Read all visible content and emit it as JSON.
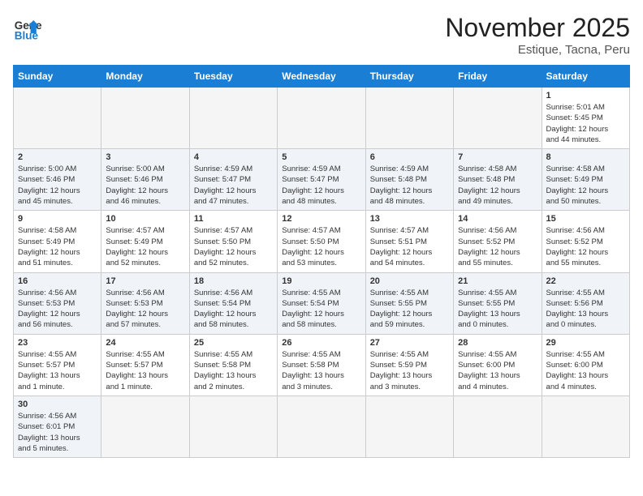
{
  "header": {
    "logo_line1": "General",
    "logo_line2": "Blue",
    "month": "November 2025",
    "location": "Estique, Tacna, Peru"
  },
  "days_of_week": [
    "Sunday",
    "Monday",
    "Tuesday",
    "Wednesday",
    "Thursday",
    "Friday",
    "Saturday"
  ],
  "weeks": [
    [
      {
        "day": "",
        "info": ""
      },
      {
        "day": "",
        "info": ""
      },
      {
        "day": "",
        "info": ""
      },
      {
        "day": "",
        "info": ""
      },
      {
        "day": "",
        "info": ""
      },
      {
        "day": "",
        "info": ""
      },
      {
        "day": "1",
        "info": "Sunrise: 5:01 AM\nSunset: 5:45 PM\nDaylight: 12 hours\nand 44 minutes."
      }
    ],
    [
      {
        "day": "2",
        "info": "Sunrise: 5:00 AM\nSunset: 5:46 PM\nDaylight: 12 hours\nand 45 minutes."
      },
      {
        "day": "3",
        "info": "Sunrise: 5:00 AM\nSunset: 5:46 PM\nDaylight: 12 hours\nand 46 minutes."
      },
      {
        "day": "4",
        "info": "Sunrise: 4:59 AM\nSunset: 5:47 PM\nDaylight: 12 hours\nand 47 minutes."
      },
      {
        "day": "5",
        "info": "Sunrise: 4:59 AM\nSunset: 5:47 PM\nDaylight: 12 hours\nand 48 minutes."
      },
      {
        "day": "6",
        "info": "Sunrise: 4:59 AM\nSunset: 5:48 PM\nDaylight: 12 hours\nand 48 minutes."
      },
      {
        "day": "7",
        "info": "Sunrise: 4:58 AM\nSunset: 5:48 PM\nDaylight: 12 hours\nand 49 minutes."
      },
      {
        "day": "8",
        "info": "Sunrise: 4:58 AM\nSunset: 5:49 PM\nDaylight: 12 hours\nand 50 minutes."
      }
    ],
    [
      {
        "day": "9",
        "info": "Sunrise: 4:58 AM\nSunset: 5:49 PM\nDaylight: 12 hours\nand 51 minutes."
      },
      {
        "day": "10",
        "info": "Sunrise: 4:57 AM\nSunset: 5:49 PM\nDaylight: 12 hours\nand 52 minutes."
      },
      {
        "day": "11",
        "info": "Sunrise: 4:57 AM\nSunset: 5:50 PM\nDaylight: 12 hours\nand 52 minutes."
      },
      {
        "day": "12",
        "info": "Sunrise: 4:57 AM\nSunset: 5:50 PM\nDaylight: 12 hours\nand 53 minutes."
      },
      {
        "day": "13",
        "info": "Sunrise: 4:57 AM\nSunset: 5:51 PM\nDaylight: 12 hours\nand 54 minutes."
      },
      {
        "day": "14",
        "info": "Sunrise: 4:56 AM\nSunset: 5:52 PM\nDaylight: 12 hours\nand 55 minutes."
      },
      {
        "day": "15",
        "info": "Sunrise: 4:56 AM\nSunset: 5:52 PM\nDaylight: 12 hours\nand 55 minutes."
      }
    ],
    [
      {
        "day": "16",
        "info": "Sunrise: 4:56 AM\nSunset: 5:53 PM\nDaylight: 12 hours\nand 56 minutes."
      },
      {
        "day": "17",
        "info": "Sunrise: 4:56 AM\nSunset: 5:53 PM\nDaylight: 12 hours\nand 57 minutes."
      },
      {
        "day": "18",
        "info": "Sunrise: 4:56 AM\nSunset: 5:54 PM\nDaylight: 12 hours\nand 58 minutes."
      },
      {
        "day": "19",
        "info": "Sunrise: 4:55 AM\nSunset: 5:54 PM\nDaylight: 12 hours\nand 58 minutes."
      },
      {
        "day": "20",
        "info": "Sunrise: 4:55 AM\nSunset: 5:55 PM\nDaylight: 12 hours\nand 59 minutes."
      },
      {
        "day": "21",
        "info": "Sunrise: 4:55 AM\nSunset: 5:55 PM\nDaylight: 13 hours\nand 0 minutes."
      },
      {
        "day": "22",
        "info": "Sunrise: 4:55 AM\nSunset: 5:56 PM\nDaylight: 13 hours\nand 0 minutes."
      }
    ],
    [
      {
        "day": "23",
        "info": "Sunrise: 4:55 AM\nSunset: 5:57 PM\nDaylight: 13 hours\nand 1 minute."
      },
      {
        "day": "24",
        "info": "Sunrise: 4:55 AM\nSunset: 5:57 PM\nDaylight: 13 hours\nand 1 minute."
      },
      {
        "day": "25",
        "info": "Sunrise: 4:55 AM\nSunset: 5:58 PM\nDaylight: 13 hours\nand 2 minutes."
      },
      {
        "day": "26",
        "info": "Sunrise: 4:55 AM\nSunset: 5:58 PM\nDaylight: 13 hours\nand 3 minutes."
      },
      {
        "day": "27",
        "info": "Sunrise: 4:55 AM\nSunset: 5:59 PM\nDaylight: 13 hours\nand 3 minutes."
      },
      {
        "day": "28",
        "info": "Sunrise: 4:55 AM\nSunset: 6:00 PM\nDaylight: 13 hours\nand 4 minutes."
      },
      {
        "day": "29",
        "info": "Sunrise: 4:55 AM\nSunset: 6:00 PM\nDaylight: 13 hours\nand 4 minutes."
      }
    ],
    [
      {
        "day": "30",
        "info": "Sunrise: 4:56 AM\nSunset: 6:01 PM\nDaylight: 13 hours\nand 5 minutes."
      },
      {
        "day": "",
        "info": ""
      },
      {
        "day": "",
        "info": ""
      },
      {
        "day": "",
        "info": ""
      },
      {
        "day": "",
        "info": ""
      },
      {
        "day": "",
        "info": ""
      },
      {
        "day": "",
        "info": ""
      }
    ]
  ]
}
